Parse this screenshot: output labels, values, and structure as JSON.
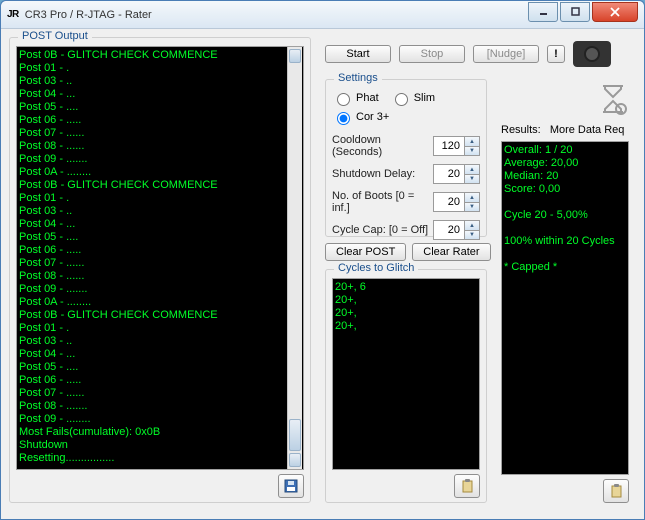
{
  "window": {
    "logo": "JR",
    "title": "CR3 Pro / R-JTAG - Rater"
  },
  "toolbar": {
    "start": "Start",
    "stop": "Stop",
    "nudge": "[Nudge]",
    "alert": "!"
  },
  "post_output": {
    "title": "POST Output",
    "lines": [
      "Post 0B - GLITCH CHECK COMMENCE",
      "Post 01 - .",
      "Post 03 - ..",
      "Post 04 - ...",
      "Post 05 - ....",
      "Post 06 - .....",
      "Post 07 - ......",
      "Post 08 - ......",
      "Post 09 - .......",
      "Post 0A - ........",
      "Post 0B - GLITCH CHECK COMMENCE",
      "Post 01 - .",
      "Post 03 - ..",
      "Post 04 - ...",
      "Post 05 - ....",
      "Post 06 - .....",
      "Post 07 - ......",
      "Post 08 - ......",
      "Post 09 - .......",
      "Post 0A - ........",
      "Post 0B - GLITCH CHECK COMMENCE",
      "Post 01 - .",
      "Post 03 - ..",
      "Post 04 - ...",
      "Post 05 - ....",
      "Post 06 - .....",
      "Post 07 - ......",
      "Post 08 - .......",
      "Post 09 - ........",
      "Most Fails(cumulative): 0x0B",
      "Shutdown",
      "Resetting................"
    ]
  },
  "settings": {
    "title": "Settings",
    "radios": {
      "phat": "Phat",
      "slim": "Slim",
      "cor3": "Cor 3+"
    },
    "cooldown_label": "Cooldown (Seconds)",
    "cooldown": "120",
    "shutdown_label": "Shutdown Delay:",
    "shutdown": "20",
    "boots_label": "No. of Boots [0 = inf.]",
    "boots": "20",
    "cycle_label": "Cycle Cap:   [0 = Off]",
    "cycle": "20"
  },
  "buttons": {
    "clear_post": "Clear POST",
    "clear_rater": "Clear Rater"
  },
  "cycles": {
    "title": "Cycles to Glitch",
    "lines": [
      "20+, 6",
      "20+,",
      "20+,",
      "20+,"
    ]
  },
  "results": {
    "label": "Results:",
    "status": "More Data Req",
    "lines": [
      "Overall: 1 / 20",
      "Average: 20,00",
      "Median: 20",
      "Score: 0,00",
      "",
      "Cycle 20 - 5,00%",
      "",
      "100% within 20 Cycles",
      "",
      "* Capped *"
    ]
  }
}
